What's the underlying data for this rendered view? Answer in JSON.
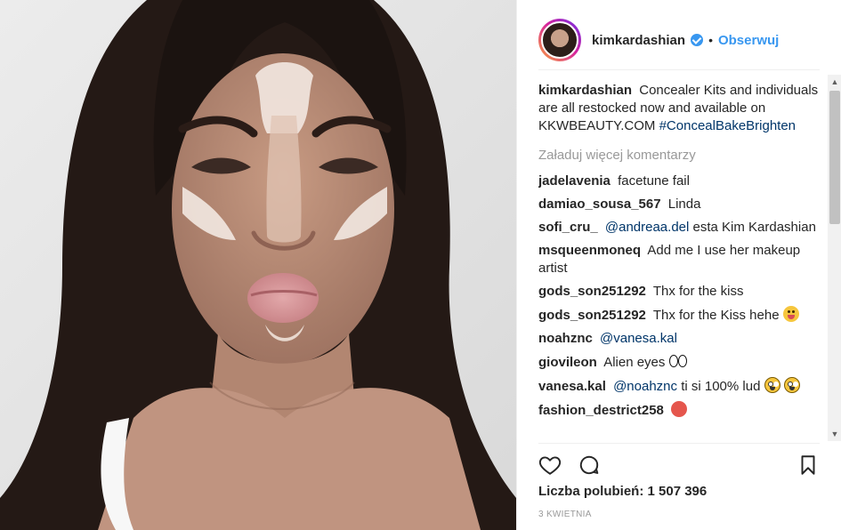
{
  "post": {
    "author": "kimkardashian",
    "follow_label": "Obserwuj",
    "verified": true
  },
  "caption": {
    "user": "kimkardashian",
    "text": "Concealer Kits and individuals are all restocked now and available on KKWBEAUTY.COM",
    "hashtag": "#ConcealBakeBrighten"
  },
  "load_more": "Załaduj więcej komentarzy",
  "comments": [
    {
      "user": "jadelavenia",
      "text": "facetune fail"
    },
    {
      "user": "damiao_sousa_567",
      "text": "Linda"
    },
    {
      "user": "sofi_cru_",
      "mention": "@andreaa.del",
      "text": "esta Kim Kardashian"
    },
    {
      "user": "msqueenmoneq",
      "text": "Add me I use her makeup artist"
    },
    {
      "user": "gods_son251292",
      "text": "Thx for the kiss"
    },
    {
      "user": "gods_son251292",
      "text": "Thx for the Kiss hehe"
    },
    {
      "user": "noahznc",
      "mention": "@vanesa.kal",
      "text": ""
    },
    {
      "user": "giovileon",
      "text": "Alien eyes"
    },
    {
      "user": "vanesa.kal",
      "mention": "@noahznc",
      "text": "ti si 100% lud"
    },
    {
      "user": "fashion_destrict258",
      "text": ""
    }
  ],
  "likes_label": "Liczba polubień: 1 507 396",
  "date": "3 KWIETNIA",
  "icons": {
    "like": "heart-outline-icon",
    "comment": "comment-bubble-icon",
    "save": "bookmark-outline-icon",
    "verified": "verified-badge-icon"
  },
  "colors": {
    "link": "#3897f0",
    "mention": "#003569",
    "muted": "#999999",
    "text": "#262626"
  }
}
